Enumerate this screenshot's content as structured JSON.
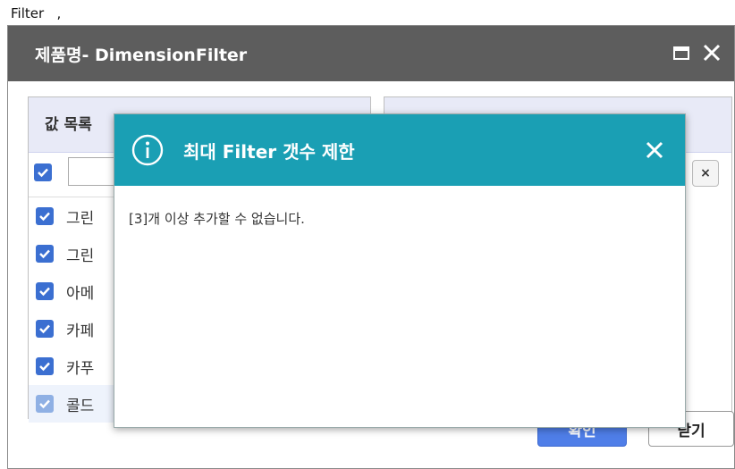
{
  "caption": "Filter   ,",
  "dialog": {
    "title": "제품명- DimensionFilter",
    "maximize_icon": "maximize-icon",
    "close_icon": "close-icon"
  },
  "left_panel": {
    "header": "값 목록",
    "filter_value": "",
    "items": [
      {
        "label": "그린",
        "checked": true
      },
      {
        "label": "그린",
        "checked": true
      },
      {
        "label": "아메",
        "checked": true
      },
      {
        "label": "카페",
        "checked": true
      },
      {
        "label": "카푸",
        "checked": true
      },
      {
        "label": "콜드",
        "checked": true
      }
    ]
  },
  "right_panel": {
    "clear_label": "×"
  },
  "buttons": {
    "ok": "확인",
    "close": "닫기"
  },
  "alert": {
    "title": "최대 Filter 갯수 제한",
    "message": "[3]개 이상 추가할 수 없습니다.",
    "info_icon": "info-icon",
    "close_icon": "close-icon"
  },
  "colors": {
    "titlebar": "#5d5d5d",
    "alert_header": "#1a9fb4",
    "checkbox": "#3b6fd1",
    "primary_button": "#4f7ee8"
  }
}
